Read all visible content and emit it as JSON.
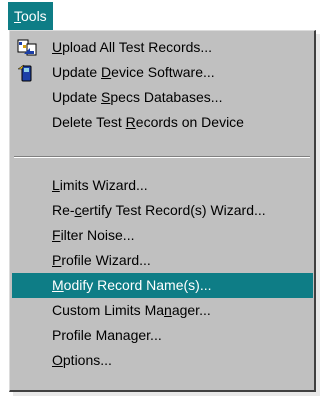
{
  "menubar": {
    "tools": {
      "mnemonic": "T",
      "rest": "ools"
    }
  },
  "menu": {
    "group1": [
      {
        "pre": "",
        "mn": "U",
        "post": "pload All Test Records...",
        "icon": "upload-icon"
      },
      {
        "pre": "Update ",
        "mn": "D",
        "post": "evice Software...",
        "icon": "update-device-icon"
      },
      {
        "pre": "Update ",
        "mn": "S",
        "post": "pecs Databases..."
      },
      {
        "pre": "Delete Test ",
        "mn": "R",
        "post": "ecords on Device"
      }
    ],
    "group2": [
      {
        "pre": "",
        "mn": "L",
        "post": "imits Wizard..."
      },
      {
        "pre": "Re-",
        "mn": "c",
        "post": "ertify Test Record(s) Wizard..."
      },
      {
        "pre": "",
        "mn": "F",
        "post": "ilter Noise..."
      },
      {
        "pre": "",
        "mn": "P",
        "post": "rofile Wizard..."
      },
      {
        "pre": "",
        "mn": "M",
        "post": "odify Record Name(s)...",
        "highlighted": true
      },
      {
        "pre": "Custom Limits Ma",
        "mn": "n",
        "post": "ager..."
      },
      {
        "pre": "Profile Manager...",
        "mn": "",
        "post": ""
      },
      {
        "pre": "",
        "mn": "O",
        "post": "ptions..."
      }
    ]
  },
  "colors": {
    "accent": "#0e7d86",
    "menu_bg": "#c0c0c0"
  }
}
